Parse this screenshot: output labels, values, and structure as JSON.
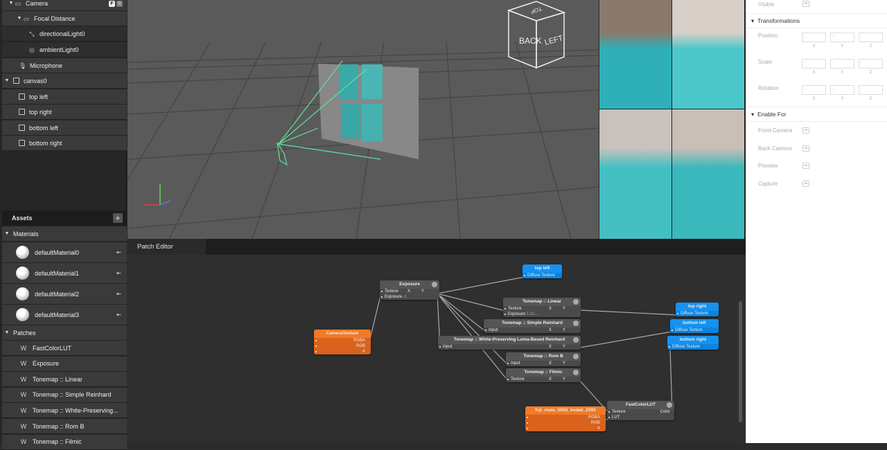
{
  "scene": {
    "items": [
      {
        "label": "Camera",
        "icon": "camera-icon",
        "badges": [
          "F",
          "B"
        ]
      },
      {
        "label": "Focal Distance",
        "icon": "focal-distance-icon"
      },
      {
        "label": "directionalLight0",
        "icon": "directional-light-icon"
      },
      {
        "label": "ambientLight0",
        "icon": "ambient-light-icon"
      },
      {
        "label": "Microphone",
        "icon": "microphone-icon"
      },
      {
        "label": "canvas0",
        "icon": "canvas-icon"
      },
      {
        "label": "top left",
        "icon": "rectangle-icon"
      },
      {
        "label": "top right",
        "icon": "rectangle-icon"
      },
      {
        "label": "bottom left",
        "icon": "rectangle-icon"
      },
      {
        "label": "bottom right",
        "icon": "rectangle-icon"
      }
    ]
  },
  "assets": {
    "title": "Assets",
    "add": "+",
    "materials_header": "Materials",
    "materials": [
      "defaultMaterial0",
      "defaultMaterial1",
      "defaultMaterial2",
      "defaultMaterial3"
    ],
    "patches_header": "Patches",
    "patches": [
      "FastColorLUT",
      "Exposure",
      "Tonemap ::  Linear",
      "Tonemap :: Simple Reinhard",
      "Tonemap :: White-Preserving...",
      "Tonemap :: Rom B",
      "Tonemap :: Filmic"
    ]
  },
  "viewport": {
    "cube": {
      "front": "BACK",
      "side": "LEFT",
      "top": "TOP"
    },
    "wire_color": "#5fe39a"
  },
  "patch_editor": {
    "tab": "Patch Editor",
    "nodes": {
      "top_left": {
        "title": "top left",
        "port": "Diffuse Texture"
      },
      "top_right": {
        "title": "top right",
        "port": "Diffuse Texture"
      },
      "bottom_left": {
        "title": "bottom left",
        "port": "Diffuse Texture"
      },
      "bottom_right": {
        "title": "bottom right",
        "port": "Diffuse Texture"
      },
      "exposure": {
        "title": "Exposure",
        "in1": "Texture",
        "in2": "Exposure",
        "in2_val": "-1",
        "x": "X",
        "y": "Y"
      },
      "camera": {
        "title": "CameraTexture",
        "o1": "RGBA",
        "o2": "RGB",
        "o3": "A"
      },
      "linear": {
        "title": "Tonemap ::  Linear",
        "in1": "Texture",
        "in2": "Exposure",
        "in2_val": "1.01...",
        "x": "X",
        "y": "Y"
      },
      "reinhard": {
        "title": "Tonemap :: Simple Reinhard",
        "in1": "Input",
        "x": "X",
        "y": "Y"
      },
      "white": {
        "title": "Tonemap :: White-Preserving Luma-Based Reinhard",
        "in1": "Input",
        "x": "X",
        "y": "Y"
      },
      "romb": {
        "title": "Tonemap :: Rom B",
        "in1": "Input",
        "x": "X",
        "y": "Y"
      },
      "filmic": {
        "title": "Tonemap :: Filmic",
        "in1": "Texture",
        "x": "X",
        "y": "Y"
      },
      "lut_tex": {
        "title": "fuji_reala_500d_kodak_2393",
        "o1": "RGBA",
        "o2": "RGB",
        "o3": "A"
      },
      "fastlut": {
        "title": "FastColorLUT",
        "in1": "Texture",
        "in2": "LUT",
        "out": "Color"
      }
    },
    "colors": {
      "patch": "#0a84e0",
      "asset": "#f07a26"
    }
  },
  "inspector": {
    "visible": "Visible",
    "transformations": "Transformations",
    "props": [
      {
        "label": "Position"
      },
      {
        "label": "Scale"
      },
      {
        "label": "Rotation"
      }
    ],
    "field_value": "-",
    "axes": [
      "X",
      "Y",
      "Z"
    ],
    "enable_for": "Enable For",
    "enable": [
      "Front Camera",
      "Back Camera",
      "Preview",
      "Capture"
    ]
  }
}
